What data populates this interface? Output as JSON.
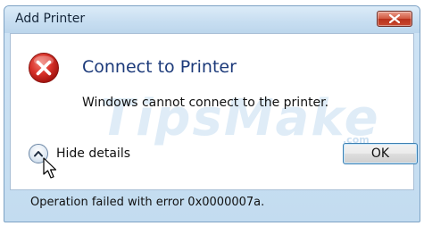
{
  "window": {
    "title": "Add Printer"
  },
  "dialog": {
    "heading": "Connect to Printer",
    "message": "Windows cannot connect to the printer.",
    "details_toggle_label": "Hide details",
    "ok_label": "OK",
    "details_text": "Operation failed with error 0x0000007a."
  },
  "watermark": {
    "text": "TipsMake",
    "suffix": ".com"
  },
  "icons": {
    "error": "error-icon",
    "close": "close-icon",
    "collapse": "chevron-up-icon",
    "cursor": "mouse-pointer-icon"
  },
  "colors": {
    "heading": "#1c3a7a",
    "close_button": "#c8472d",
    "error_icon": "#c8281e",
    "ok_border": "#3c7fb1",
    "frame": "#c3dcf0"
  }
}
